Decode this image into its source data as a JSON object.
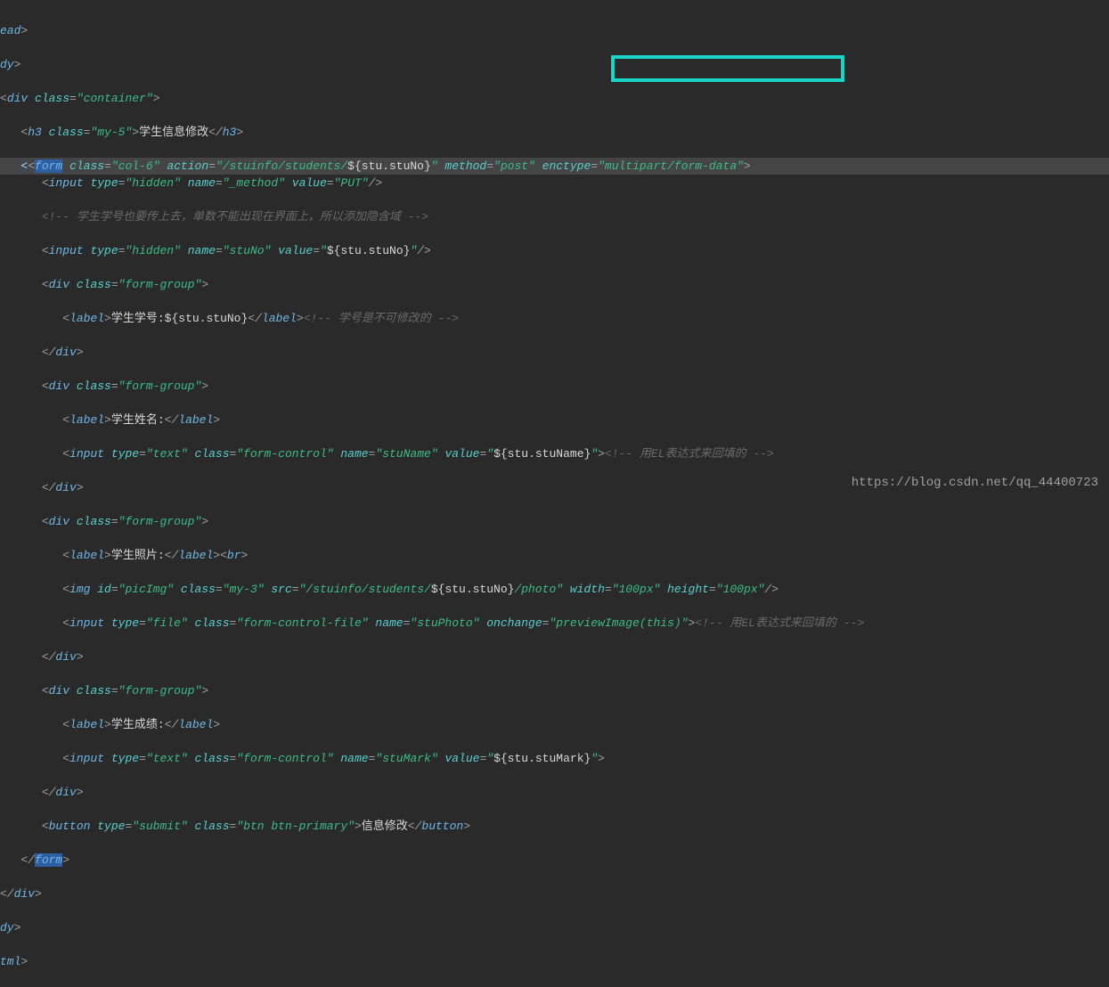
{
  "tags": {
    "ead": "ead",
    "dy": "dy",
    "div": "div",
    "form": "form",
    "h3": "h3",
    "input": "input",
    "label": "label",
    "br": "br",
    "img": "img",
    "button": "button",
    "tml": "tml"
  },
  "attrs": {
    "class": "class",
    "action": "action",
    "method": "method",
    "enctype": "enctype",
    "type": "type",
    "name": "name",
    "value": "value",
    "id": "id",
    "src": "src",
    "width": "width",
    "height": "height",
    "onchange": "onchange"
  },
  "vals": {
    "container": "\"container\"",
    "my5": "\"my-5\"",
    "col6": "\"col-6\"",
    "actionPath": "\"/stuinfo/students/",
    "stuNoExpr": "${stu.stuNo}",
    "closeQ": "\"",
    "post": "\"post\"",
    "encv": "\"multipart/form-data\"",
    "hidden": "\"hidden\"",
    "_method": "\"_method\"",
    "PUT": "\"PUT\"",
    "stuNo": "\"stuNo\"",
    "valStuNoOpen": "\"",
    "formGroup": "\"form-group\"",
    "text": "\"text\"",
    "formControl": "\"form-control\"",
    "stuName": "\"stuName\"",
    "valStuNameOpen": "\"",
    "stuNameExpr": "${stu.stuName}",
    "picImg": "\"picImg\"",
    "my3": "\"my-3\"",
    "srcPath": "\"/stuinfo/students/",
    "photoSuffix": "/photo\"",
    "w100": "\"100px\"",
    "h100": "\"100px\"",
    "file": "\"file\"",
    "formControlFile": "\"form-control-file\"",
    "stuPhoto": "\"stuPhoto\"",
    "preview": "\"previewImage(this)\"",
    "stuMark": "\"stuMark\"",
    "valStuMarkOpen": "\"",
    "stuMarkExpr": "${stu.stuMark}",
    "submit": "\"submit\"",
    "btnPrimary": "\"btn btn-primary\""
  },
  "text": {
    "h3": "学生信息修改",
    "cmt1": "<!-- 学生学号也要传上去，单数不能出现在界面上，所以添加隐含域 -->",
    "labelStuNo": "学生学号:",
    "cmt2": "<!-- 学号是不可修改的 -->",
    "labelStuName": "学生姓名:",
    "cmt3": "<!-- 用EL表达式来回填的 -->",
    "labelStuPhoto": "学生照片:",
    "cmt4": "<!-- 用EL表达式来回填的 -->",
    "labelStuMark": "学生成绩:",
    "btn": "信息修改"
  },
  "watermark": "https://blog.csdn.net/qq_44400723"
}
